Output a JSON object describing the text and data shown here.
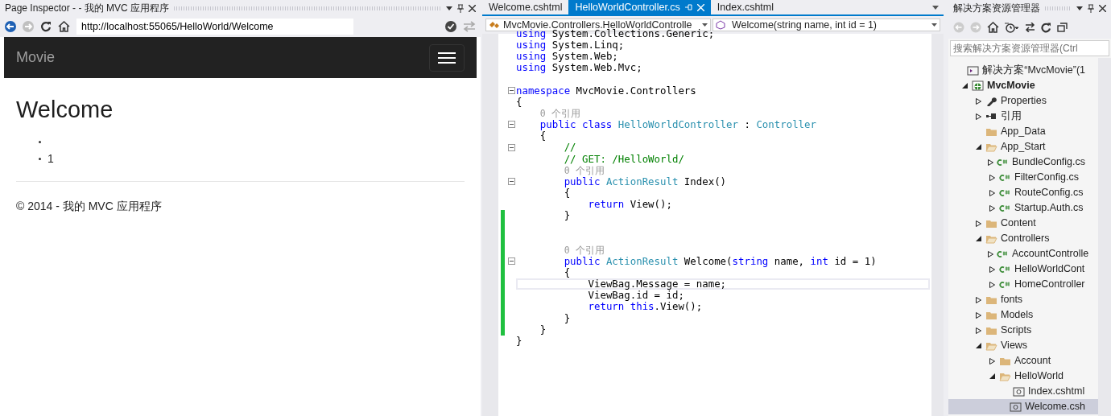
{
  "inspector": {
    "title": "Page Inspector - - 我的 MVC 应用程序",
    "url": "http://localhost:55065/HelloWorld/Welcome",
    "page": {
      "brand": "Movie",
      "heading": "Welcome",
      "bullets": [
        {
          "kind": "empty"
        },
        {
          "kind": "text",
          "text": "1"
        }
      ],
      "footer": "© 2014 - 我的 MVC 应用程序"
    }
  },
  "editor": {
    "tabs": [
      {
        "label": "Welcome.cshtml",
        "selected": false
      },
      {
        "label": "HelloWorldController.cs",
        "selected": true
      },
      {
        "label": "Index.cshtml",
        "selected": false
      }
    ],
    "type_combo": "MvcMovie.Controllers.HelloWorldControlle",
    "member_combo": "Welcome(string name, int id = 1)",
    "lines": [
      {
        "kind": "code",
        "fold": false,
        "changed": false,
        "current": false,
        "tokens": [
          {
            "kind": "kw",
            "text": "using"
          },
          {
            "kind": "plain",
            "text": " System.Collections.Generic;"
          }
        ]
      },
      {
        "kind": "code",
        "fold": false,
        "changed": false,
        "current": false,
        "tokens": [
          {
            "kind": "kw",
            "text": "using"
          },
          {
            "kind": "plain",
            "text": " System.Linq;"
          }
        ]
      },
      {
        "kind": "code",
        "fold": false,
        "changed": false,
        "current": false,
        "tokens": [
          {
            "kind": "kw",
            "text": "using"
          },
          {
            "kind": "plain",
            "text": " System.Web;"
          }
        ]
      },
      {
        "kind": "code",
        "fold": false,
        "changed": false,
        "current": false,
        "tokens": [
          {
            "kind": "kw",
            "text": "using"
          },
          {
            "kind": "plain",
            "text": " System.Web.Mvc;"
          }
        ]
      },
      {
        "kind": "blank"
      },
      {
        "kind": "code",
        "fold": true,
        "changed": false,
        "current": false,
        "tokens": [
          {
            "kind": "kw",
            "text": "namespace"
          },
          {
            "kind": "plain",
            "text": " MvcMovie.Controllers"
          }
        ]
      },
      {
        "kind": "code",
        "fold": false,
        "changed": false,
        "current": false,
        "tokens": [
          {
            "kind": "plain",
            "text": "{"
          }
        ]
      },
      {
        "kind": "block",
        "lines": [
          {
            "kind": "codelens",
            "text": "0 个引用"
          },
          {
            "kind": "code",
            "fold": true,
            "changed": false,
            "current": false,
            "tokens": [
              {
                "kind": "kw",
                "text": "public class "
              },
              {
                "kind": "type",
                "text": "HelloWorldController"
              },
              {
                "kind": "plain",
                "text": " : "
              },
              {
                "kind": "type",
                "text": "Controller"
              }
            ]
          },
          {
            "kind": "code",
            "fold": false,
            "changed": false,
            "current": false,
            "tokens": [
              {
                "kind": "plain",
                "text": "{"
              }
            ]
          },
          {
            "kind": "block",
            "lines": [
              {
                "kind": "code",
                "fold": true,
                "changed": false,
                "current": false,
                "tokens": [
                  {
                    "kind": "comment",
                    "text": "//"
                  }
                ]
              },
              {
                "kind": "code",
                "fold": false,
                "changed": false,
                "current": false,
                "tokens": [
                  {
                    "kind": "comment",
                    "text": "// GET: /HelloWorld/"
                  }
                ]
              },
              {
                "kind": "codelens",
                "text": "0 个引用"
              },
              {
                "kind": "code",
                "fold": true,
                "changed": false,
                "current": false,
                "tokens": [
                  {
                    "kind": "kw",
                    "text": "public "
                  },
                  {
                    "kind": "type",
                    "text": "ActionResult"
                  },
                  {
                    "kind": "plain",
                    "text": " Index()"
                  }
                ]
              },
              {
                "kind": "code",
                "fold": false,
                "changed": false,
                "current": false,
                "tokens": [
                  {
                    "kind": "plain",
                    "text": "{"
                  }
                ]
              },
              {
                "kind": "block",
                "lines": [
                  {
                    "kind": "code",
                    "fold": false,
                    "changed": false,
                    "current": false,
                    "tokens": [
                      {
                        "kind": "kw",
                        "text": "return"
                      },
                      {
                        "kind": "plain",
                        "text": " View();"
                      }
                    ]
                  }
                ]
              },
              {
                "kind": "code",
                "fold": false,
                "changed": true,
                "current": false,
                "tokens": [
                  {
                    "kind": "plain",
                    "text": "}"
                  }
                ]
              },
              {
                "kind": "blank",
                "changed": true
              },
              {
                "kind": "blank",
                "changed": true
              },
              {
                "kind": "codelens",
                "changed": true,
                "text": "0 个引用"
              },
              {
                "kind": "code",
                "fold": true,
                "changed": true,
                "current": false,
                "tokens": [
                  {
                    "kind": "kw",
                    "text": "public "
                  },
                  {
                    "kind": "type",
                    "text": "ActionResult"
                  },
                  {
                    "kind": "plain",
                    "text": " Welcome("
                  },
                  {
                    "kind": "kw",
                    "text": "string"
                  },
                  {
                    "kind": "plain",
                    "text": " name, "
                  },
                  {
                    "kind": "kw",
                    "text": "int"
                  },
                  {
                    "kind": "plain",
                    "text": " id = 1)"
                  }
                ]
              },
              {
                "kind": "code",
                "fold": false,
                "changed": true,
                "current": false,
                "tokens": [
                  {
                    "kind": "plain",
                    "text": "{"
                  }
                ]
              },
              {
                "kind": "block",
                "lines": [
                  {
                    "kind": "code",
                    "fold": false,
                    "changed": true,
                    "current": true,
                    "tokens": [
                      {
                        "kind": "plain",
                        "text": "ViewBag.Message = name;"
                      }
                    ]
                  },
                  {
                    "kind": "code",
                    "fold": false,
                    "changed": true,
                    "current": false,
                    "tokens": [
                      {
                        "kind": "plain",
                        "text": "ViewBag.id = id;"
                      }
                    ]
                  },
                  {
                    "kind": "code",
                    "fold": false,
                    "changed": true,
                    "current": false,
                    "tokens": [
                      {
                        "kind": "kw",
                        "text": "return this"
                      },
                      {
                        "kind": "plain",
                        "text": ".View();"
                      }
                    ]
                  }
                ]
              },
              {
                "kind": "code",
                "fold": false,
                "changed": true,
                "current": false,
                "tokens": [
                  {
                    "kind": "plain",
                    "text": "}"
                  }
                ]
              }
            ]
          },
          {
            "kind": "code",
            "fold": false,
            "changed": true,
            "current": false,
            "tokens": [
              {
                "kind": "plain",
                "text": "}"
              }
            ]
          }
        ]
      },
      {
        "kind": "code",
        "fold": false,
        "changed": false,
        "current": false,
        "tokens": [
          {
            "kind": "plain",
            "text": "}"
          }
        ]
      }
    ]
  },
  "explorer": {
    "title": "解决方案资源管理器",
    "search_placeholder": "搜索解决方案资源管理器(Ctrl",
    "tree": [
      {
        "label": "解决方案“MvcMovie”(1",
        "kind": "solution",
        "selected": false,
        "children": [
          {
            "label": "MvcMovie",
            "kind": "project",
            "expanded": true,
            "selected": false,
            "children": [
              {
                "label": "Properties",
                "kind": "properties",
                "expanded": false,
                "selected": false
              },
              {
                "label": "引用",
                "kind": "references",
                "expanded": false,
                "selected": false
              },
              {
                "label": "App_Data",
                "kind": "folder",
                "selected": false
              },
              {
                "label": "App_Start",
                "kind": "folder",
                "expanded": true,
                "selected": false,
                "children": [
                  {
                    "label": "BundleConfig.cs",
                    "kind": "cs",
                    "expanded": false,
                    "selected": false
                  },
                  {
                    "label": "FilterConfig.cs",
                    "kind": "cs",
                    "expanded": false,
                    "selected": false
                  },
                  {
                    "label": "RouteConfig.cs",
                    "kind": "cs",
                    "expanded": false,
                    "selected": false
                  },
                  {
                    "label": "Startup.Auth.cs",
                    "kind": "cs",
                    "expanded": false,
                    "selected": false
                  }
                ]
              },
              {
                "label": "Content",
                "kind": "folder",
                "expanded": false,
                "selected": false
              },
              {
                "label": "Controllers",
                "kind": "folder",
                "expanded": true,
                "selected": false,
                "children": [
                  {
                    "label": "AccountControlle",
                    "kind": "cs",
                    "expanded": false,
                    "selected": false
                  },
                  {
                    "label": "HelloWorldCont",
                    "kind": "cs",
                    "expanded": false,
                    "selected": false
                  },
                  {
                    "label": "HomeController",
                    "kind": "cs",
                    "expanded": false,
                    "selected": false
                  }
                ]
              },
              {
                "label": "fonts",
                "kind": "folder",
                "expanded": false,
                "selected": false
              },
              {
                "label": "Models",
                "kind": "folder",
                "expanded": false,
                "selected": false
              },
              {
                "label": "Scripts",
                "kind": "folder",
                "expanded": false,
                "selected": false
              },
              {
                "label": "Views",
                "kind": "folder",
                "expanded": true,
                "selected": false,
                "children": [
                  {
                    "label": "Account",
                    "kind": "folder",
                    "expanded": false,
                    "selected": false
                  },
                  {
                    "label": "HelloWorld",
                    "kind": "folder",
                    "expanded": true,
                    "selected": false,
                    "children": [
                      {
                        "label": "Index.cshtml",
                        "kind": "cshtml",
                        "selected": false
                      },
                      {
                        "label": "Welcome.csh",
                        "kind": "cshtml",
                        "selected": true
                      }
                    ]
                  }
                ]
              }
            ]
          }
        ]
      }
    ]
  }
}
